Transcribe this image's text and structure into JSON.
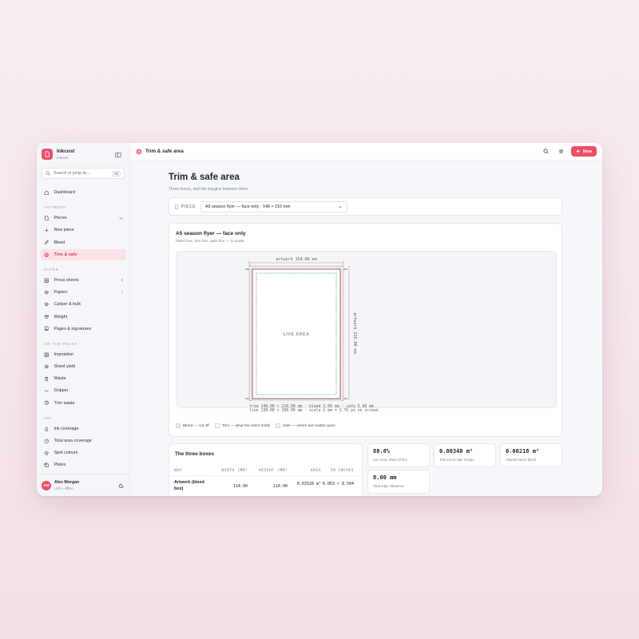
{
  "app": {
    "name": "Inkcost",
    "workspace": "Inkcost",
    "search_placeholder": "Search or jump to...",
    "search_shortcut": "⌘K"
  },
  "sidebar": {
    "dashboard": "Dashboard",
    "sections": {
      "artwork": "ARTWORK",
      "paper": "PAPER",
      "press": "ON THE PRESS",
      "ink": "INK"
    },
    "items": {
      "pieces": {
        "label": "Pieces",
        "count": "10"
      },
      "new_piece": {
        "label": "New piece"
      },
      "bleed": {
        "label": "Bleed"
      },
      "trim_safe": {
        "label": "Trim & safe"
      },
      "press_sheets": {
        "label": "Press sheets",
        "count": "6"
      },
      "papers": {
        "label": "Papers",
        "count": "7"
      },
      "caliper": {
        "label": "Caliper & bulk"
      },
      "weight": {
        "label": "Weight"
      },
      "pages": {
        "label": "Pages & signatures"
      },
      "imposition": {
        "label": "Imposition"
      },
      "sheet_yield": {
        "label": "Sheet yield"
      },
      "waste": {
        "label": "Waste"
      },
      "gripper": {
        "label": "Gripper"
      },
      "trim_waste": {
        "label": "Trim waste"
      },
      "ink_coverage": {
        "label": "Ink coverage"
      },
      "total_area": {
        "label": "Total area coverage"
      },
      "spot_colours": {
        "label": "Spot colours"
      },
      "plates": {
        "label": "Plates"
      }
    },
    "user": {
      "initials": "AM",
      "name": "Alex Morgan",
      "sub": "USD • offline"
    }
  },
  "topbar": {
    "title": "Trim & safe area",
    "new_label": "New"
  },
  "page": {
    "title": "Trim & safe area",
    "subtitle": "Three boxes, and the margins between them",
    "piece_label": "PIECE",
    "piece_value": "A5 season flyer — face only · 148 × 210 mm"
  },
  "diagram": {
    "title": "A5 season flyer — face only",
    "subtitle": "bleed box, trim box, safe box — to scale",
    "top_dim": "artwork 154.00 mm",
    "side_dim": "artwork 216.00 mm",
    "live_label": "LIVE AREA",
    "caption_line1": "trim 148.00 × 210.00 mm · bleed 3.00 mm · safe 5.00 mm",
    "caption_line2": "live 138.00 × 200.00 mm · scale 1 mm = 1.76 px on screen",
    "legend": [
      {
        "label": "Bleed — cut off",
        "color": "#f6e6ea"
      },
      {
        "label": "Trim — what the client holds",
        "color": "#ffffff"
      },
      {
        "label": "Safe — where live matter goes",
        "color": "#e3f3ea"
      }
    ],
    "colors": {
      "bleed": "#f6e6ea",
      "trim": "#7d5a66",
      "safe": "#3aa468",
      "crop": "#7d5a66"
    }
  },
  "boxes": {
    "title": "The three boxes",
    "headers": [
      "BOX",
      "WIDTH (MM)",
      "HEIGHT (MM)",
      "AREA",
      "IN INCHES"
    ],
    "rows": [
      {
        "box": "Artwork (bleed box)",
        "width": "154.00",
        "height": "216.00",
        "area": "0.03326 m²",
        "inches": "6.063 × 8.504"
      }
    ]
  },
  "stats": [
    {
      "value": "88.8%",
      "label": "Live area, share of trim"
    },
    {
      "value": "0.00348 m²",
      "label": "Trim lost to safe margin"
    },
    {
      "value": "0.00218 m²",
      "label": "Artwork lost to bleed"
    },
    {
      "value": "8.00 mm",
      "label": "Total edge allowance"
    }
  ]
}
